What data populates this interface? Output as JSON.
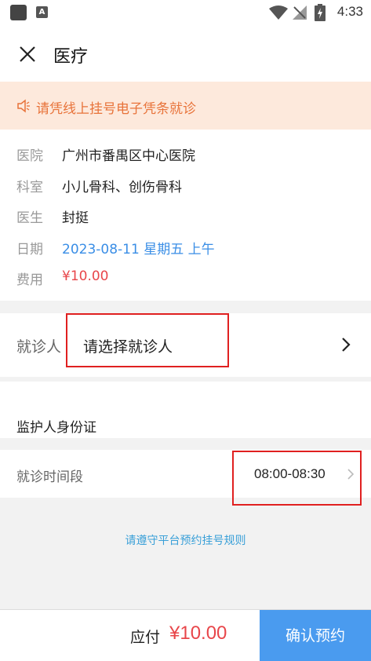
{
  "status_bar": {
    "app_a_glyph": "A",
    "time": "4:33"
  },
  "header": {
    "title": "医疗"
  },
  "notice": {
    "text": "请凭线上挂号电子凭条就诊"
  },
  "info": {
    "hospital_label": "医院",
    "hospital_value": "广州市番禺区中心医院",
    "dept_label": "科室",
    "dept_value": "小儿骨科、创伤骨科",
    "doctor_label": "医生",
    "doctor_value": "封挺",
    "date_label": "日期",
    "date_value": "2023-08-11 星期五 上午",
    "fee_label": "费用",
    "fee_value": "¥10.00"
  },
  "patient": {
    "label": "就诊人",
    "placeholder": "请选择就诊人"
  },
  "guardian": {
    "label": "监护人身份证"
  },
  "timeslot": {
    "label": "就诊时间段",
    "value": "08:00-08:30"
  },
  "rules_link": "请遵守平台预约挂号规则",
  "footer": {
    "pay_label": "应付",
    "pay_amount": "¥10.00",
    "confirm_label": "确认预约"
  },
  "colors": {
    "accent_blue": "#4a9bef",
    "price_red": "#e8464a",
    "notice_orange": "#e8733a",
    "notice_bg": "#fde9dc",
    "highlight_red": "#e02020"
  },
  "icons": {
    "close": "close-icon",
    "speaker": "speaker-icon",
    "chevron": "chevron-right-icon",
    "wifi": "wifi-icon",
    "signal": "no-signal-icon",
    "battery": "battery-charging-icon"
  }
}
